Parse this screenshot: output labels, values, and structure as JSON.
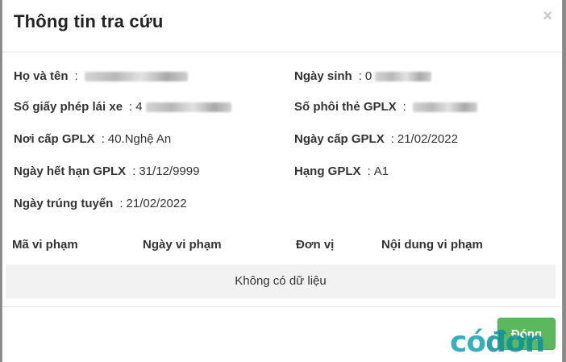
{
  "dialog": {
    "title": "Thông tin tra cứu",
    "close_icon": "×"
  },
  "fields": {
    "ho_va_ten": {
      "label": "Họ và tên",
      "sep": ":"
    },
    "ngay_sinh": {
      "label": "Ngày sinh",
      "sep": ":",
      "value_prefix": "0"
    },
    "so_gplx": {
      "label": "Số giấy phép lái xe",
      "sep": ":",
      "value_prefix": "4"
    },
    "so_phoi": {
      "label": "Số phôi thẻ GPLX",
      "sep": ":"
    },
    "noi_cap": {
      "label": "Nơi cấp GPLX",
      "sep": ":",
      "value": "40.Nghệ An"
    },
    "ngay_cap": {
      "label": "Ngày cấp GPLX",
      "sep": ":",
      "value": "21/02/2022"
    },
    "ngay_het_han": {
      "label": "Ngày hết hạn GPLX",
      "sep": ":",
      "value": "31/12/9999"
    },
    "hang": {
      "label": "Hạng GPLX",
      "sep": ":",
      "value": "A1"
    },
    "ngay_trung_tuyen": {
      "label": "Ngày trúng tuyển",
      "sep": ":",
      "value": "21/02/2022"
    }
  },
  "violations_table": {
    "columns": [
      "Mã vi phạm",
      "Ngày vi phạm",
      "Đơn vị",
      "Nội dung vi phạm"
    ],
    "empty_text": "Không có dữ liệu"
  },
  "footer": {
    "close_button": "Đóng"
  },
  "watermark": {
    "part1": "có",
    "part2": "đơn"
  },
  "colors": {
    "button": "#5cb85c",
    "watermark": "#14a3b5"
  }
}
